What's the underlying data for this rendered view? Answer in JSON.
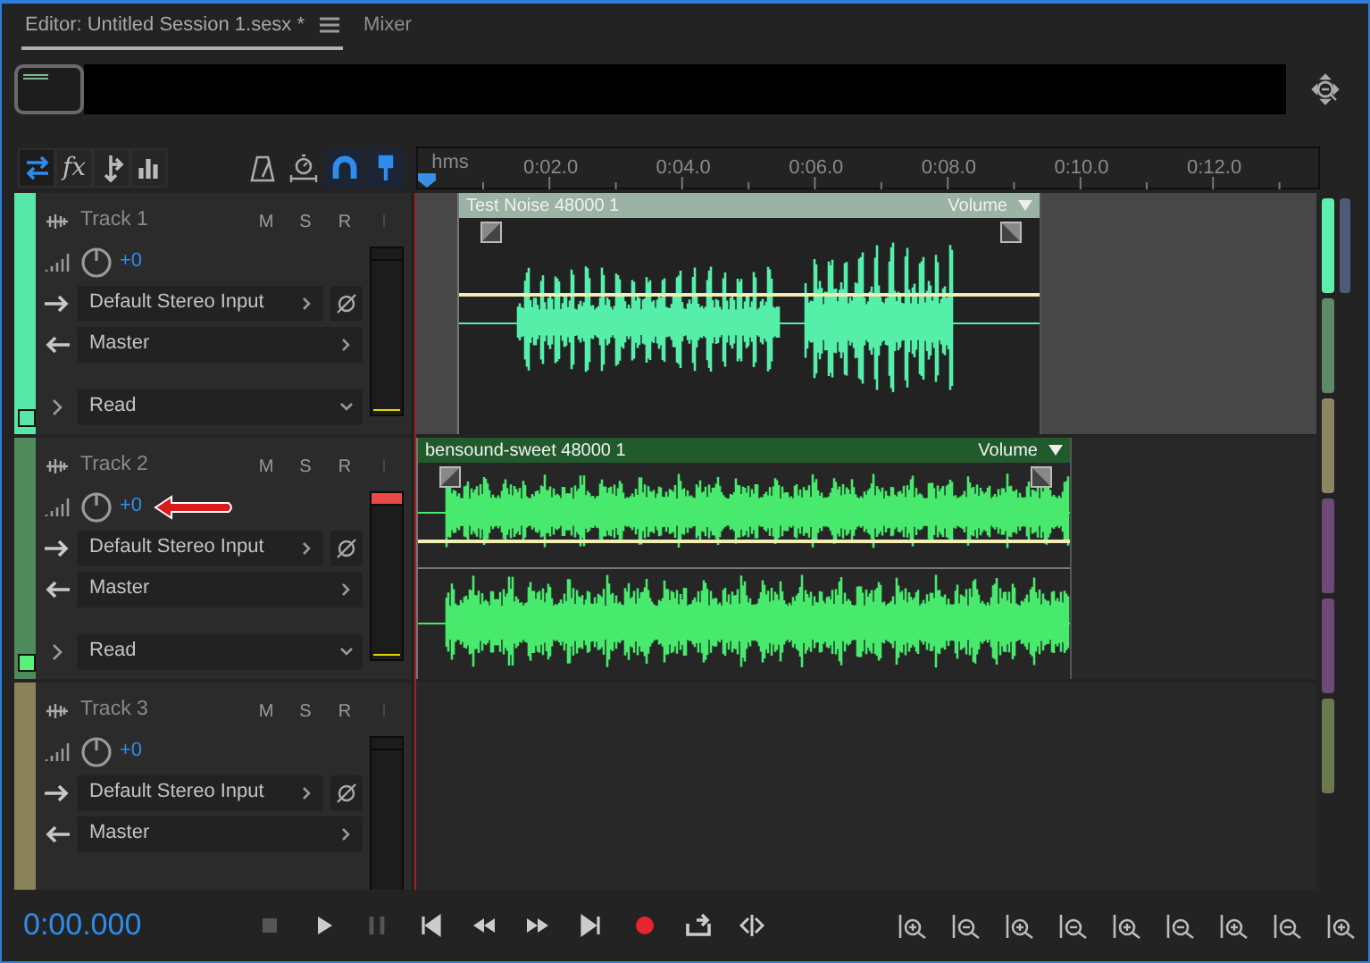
{
  "tabs": [
    {
      "label": "Editor: Untitled Session 1.sesx *",
      "selected": true
    },
    {
      "label": "Mixer",
      "selected": false
    }
  ],
  "view_buttons": [
    {
      "kind": "arrows",
      "selected": true
    },
    {
      "kind": "effects",
      "label": "fx",
      "selected": false
    },
    {
      "kind": "sends",
      "selected": false
    },
    {
      "kind": "eq",
      "selected": false
    }
  ],
  "tool_buttons": [
    {
      "kind": "metronome",
      "on": false
    },
    {
      "kind": "timer",
      "on": false
    },
    {
      "kind": "snap",
      "on": true
    },
    {
      "kind": "pin",
      "on": true
    }
  ],
  "ruler": {
    "unit": "hms",
    "ticks": [
      "0:02.0",
      "0:04.0",
      "0:06.0",
      "0:08.0",
      "0:10.0",
      "0:12.0"
    ]
  },
  "tracks": [
    {
      "name": "Track 1",
      "color": "#55e8a9",
      "selected": true,
      "checked": false,
      "annotated": false,
      "peak": false,
      "buttons": [
        {
          "label": "M",
          "disabled": false
        },
        {
          "label": "S",
          "disabled": false
        },
        {
          "label": "R",
          "disabled": false
        },
        {
          "label": "I",
          "disabled": true
        }
      ],
      "volume": "+0",
      "input": "Default Stereo Input",
      "output": "Master",
      "automation": "Read",
      "clip": {
        "kind": "mono",
        "title": "Test Noise 48000 1",
        "menu": "Volume",
        "color": "#55efaa"
      }
    },
    {
      "name": "Track 2",
      "color": "#4e8a5c",
      "selected": false,
      "checked": true,
      "annotated": true,
      "peak": true,
      "buttons": [
        {
          "label": "M",
          "disabled": false
        },
        {
          "label": "S",
          "disabled": false
        },
        {
          "label": "R",
          "disabled": false
        },
        {
          "label": "I",
          "disabled": true
        }
      ],
      "volume": "+0",
      "input": "Default Stereo Input",
      "output": "Master",
      "automation": "Read",
      "clip": {
        "kind": "stereo",
        "title": "bensound-sweet 48000 1",
        "menu": "Volume",
        "color": "#47ea6c"
      }
    },
    {
      "name": "Track 3",
      "color": "#8a8358",
      "selected": false,
      "annotated": false,
      "peak": false,
      "buttons": [
        {
          "label": "M",
          "disabled": false
        },
        {
          "label": "S",
          "disabled": false
        },
        {
          "label": "R",
          "disabled": false
        },
        {
          "label": "I",
          "disabled": true
        }
      ],
      "volume": "+0",
      "input": "Default Stereo Input",
      "output": "Master"
    }
  ],
  "overview_tracks": [
    {
      "color": "#5cf0ae"
    },
    {
      "color": "#5e8a68"
    },
    {
      "color": "#8c8560"
    },
    {
      "color": "#6e4a78"
    },
    {
      "color": "#6e4a78"
    },
    {
      "color": "#6b7a4e"
    },
    {
      "color": "#4e5a78"
    }
  ],
  "time": "0:00.000"
}
